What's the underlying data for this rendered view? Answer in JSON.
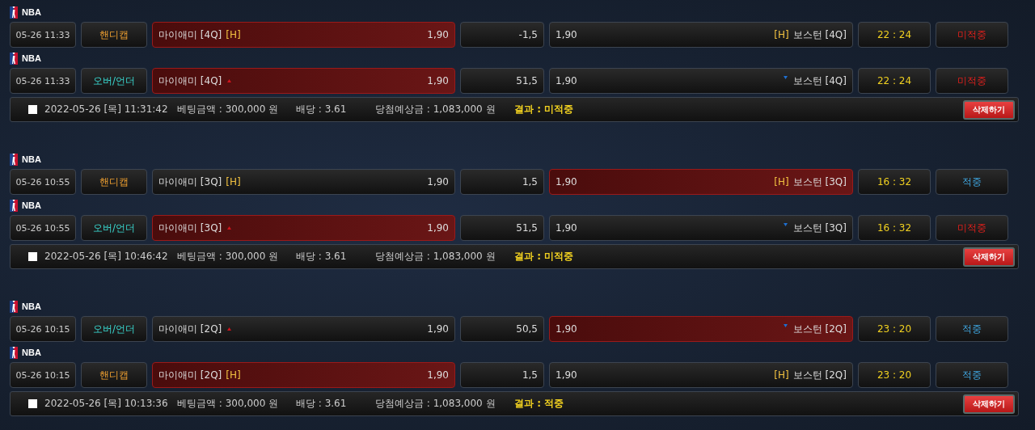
{
  "slips": [
    {
      "picks": [
        {
          "league": "NBA",
          "time": "05-26 11:33",
          "kind": "handicap",
          "market": "핸디캡",
          "home": {
            "name": "마이애미 [4Q]",
            "tag": "[H]",
            "odds": "1,90",
            "selected": true
          },
          "line": "-1,5",
          "away": {
            "name": "보스턴 [4Q]",
            "tag": "[H]",
            "odds": "1,90",
            "selected": false
          },
          "score": "22 : 24",
          "result": {
            "text": "미적중",
            "won": false
          }
        },
        {
          "league": "NBA",
          "time": "05-26 11:33",
          "kind": "over_under",
          "market": "오버/언더",
          "home": {
            "name": "마이애미 [4Q]",
            "odds": "1,90",
            "selected": true
          },
          "line": "51,5",
          "away": {
            "name": "보스턴 [4Q]",
            "odds": "1,90",
            "selected": false
          },
          "score": "22 : 24",
          "result": {
            "text": "미적중",
            "won": false
          }
        }
      ],
      "summary": {
        "checked": false,
        "date": "2022-05-26 [목] 11:31:42",
        "amount": "베팅금액 : 300,000 원",
        "odds": "배당 : 3.61",
        "payout": "당첨예상금 : 1,083,000 원",
        "result": "결과 : 미적중",
        "button": "삭제하기"
      }
    },
    {
      "picks": [
        {
          "league": "NBA",
          "time": "05-26 10:55",
          "kind": "handicap",
          "market": "핸디캡",
          "home": {
            "name": "마이애미 [3Q]",
            "tag": "[H]",
            "odds": "1,90",
            "selected": false
          },
          "line": "1,5",
          "away": {
            "name": "보스턴 [3Q]",
            "tag": "[H]",
            "odds": "1,90",
            "selected": true
          },
          "score": "16 : 32",
          "result": {
            "text": "적중",
            "won": true
          }
        },
        {
          "league": "NBA",
          "time": "05-26 10:55",
          "kind": "over_under",
          "market": "오버/언더",
          "home": {
            "name": "마이애미 [3Q]",
            "odds": "1,90",
            "selected": true
          },
          "line": "51,5",
          "away": {
            "name": "보스턴 [3Q]",
            "odds": "1,90",
            "selected": false
          },
          "score": "16 : 32",
          "result": {
            "text": "미적중",
            "won": false
          }
        }
      ],
      "summary": {
        "checked": false,
        "date": "2022-05-26 [목] 10:46:42",
        "amount": "베팅금액 : 300,000 원",
        "odds": "배당 : 3.61",
        "payout": "당첨예상금 : 1,083,000 원",
        "result": "결과 : 미적중",
        "button": "삭제하기"
      }
    },
    {
      "picks": [
        {
          "league": "NBA",
          "time": "05-26 10:15",
          "kind": "over_under",
          "market": "오버/언더",
          "home": {
            "name": "마이애미 [2Q]",
            "odds": "1,90",
            "selected": false
          },
          "line": "50,5",
          "away": {
            "name": "보스턴 [2Q]",
            "odds": "1,90",
            "selected": true
          },
          "score": "23 : 20",
          "result": {
            "text": "적중",
            "won": true
          }
        },
        {
          "league": "NBA",
          "time": "05-26 10:15",
          "kind": "handicap",
          "market": "핸디캡",
          "home": {
            "name": "마이애미 [2Q]",
            "tag": "[H]",
            "odds": "1,90",
            "selected": true
          },
          "line": "1,5",
          "away": {
            "name": "보스턴 [2Q]",
            "tag": "[H]",
            "odds": "1,90",
            "selected": false
          },
          "score": "23 : 20",
          "result": {
            "text": "적중",
            "won": true
          }
        }
      ],
      "summary": {
        "checked": false,
        "date": "2022-05-26 [목] 10:13:36",
        "amount": "베팅금액 : 300,000 원",
        "odds": "배당 : 3.61",
        "payout": "당첨예상금 : 1,083,000 원",
        "result": "결과 : 적중",
        "button": "삭제하기"
      }
    }
  ]
}
